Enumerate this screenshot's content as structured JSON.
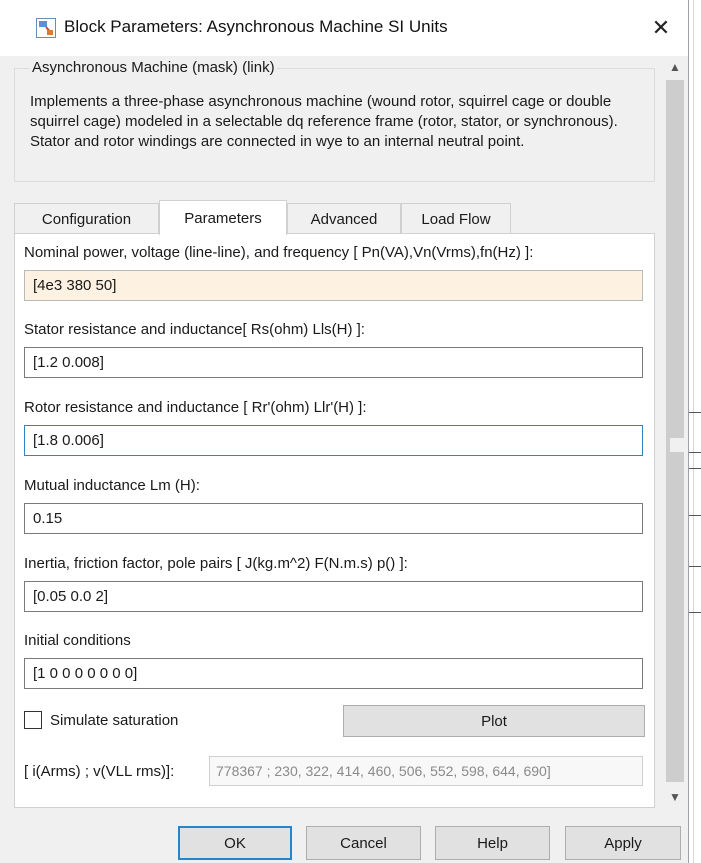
{
  "window": {
    "title": "Block Parameters: Asynchronous Machine SI Units",
    "close_glyph": "✕"
  },
  "description": {
    "group_title": "Asynchronous Machine (mask) (link)",
    "text": "Implements a three-phase asynchronous machine (wound rotor, squirrel cage or double squirrel cage) modeled in a selectable dq reference frame (rotor, stator, or synchronous). Stator and rotor windings are connected in wye to an internal neutral point."
  },
  "tabs": [
    {
      "label": "Configuration",
      "active": false
    },
    {
      "label": "Parameters",
      "active": true
    },
    {
      "label": "Advanced",
      "active": false
    },
    {
      "label": "Load Flow",
      "active": false
    }
  ],
  "params": {
    "nominal": {
      "label": "Nominal power, voltage (line-line), and frequency [ Pn(VA),Vn(Vrms),fn(Hz) ]:",
      "value": "[4e3 380 50]"
    },
    "stator": {
      "label": "Stator resistance and inductance[ Rs(ohm)  Lls(H) ]:",
      "value": "[1.2 0.008]"
    },
    "rotor": {
      "label": "Rotor resistance and inductance [ Rr'(ohm)  Llr'(H) ]:",
      "value": "[1.8 0.006]"
    },
    "mutual": {
      "label": "Mutual inductance Lm (H):",
      "value": "0.15"
    },
    "inertia": {
      "label": "Inertia, friction factor, pole pairs [ J(kg.m^2)  F(N.m.s)  p() ]:",
      "value": "[0.05 0.0 2]"
    },
    "initial": {
      "label": "Initial conditions",
      "value": "[1 0 0 0 0 0 0 0]"
    }
  },
  "saturation": {
    "checkbox_label": "Simulate saturation",
    "checked": false,
    "plot_label": "Plot",
    "values_label": "[ i(Arms) ; v(VLL rms)]:",
    "values": "778367 ; 230, 322, 414, 460, 506, 552, 598, 644, 690]"
  },
  "buttons": {
    "ok": "OK",
    "cancel": "Cancel",
    "help": "Help",
    "apply": "Apply"
  },
  "scroll": {
    "up_glyph": "▲",
    "down_glyph": "▼"
  },
  "colors": {
    "highlight_field": "#fdf1e1",
    "focus_border": "#2a84c8",
    "window_bg": "#f0f0f0"
  }
}
